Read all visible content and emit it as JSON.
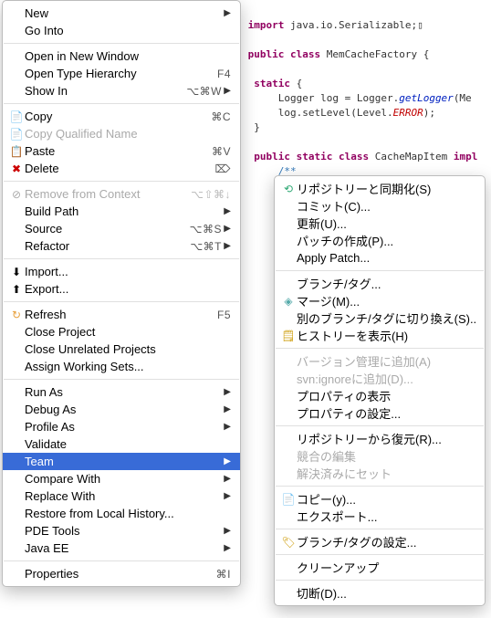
{
  "code": {
    "line1_import": "import",
    "line1_rest": " java.io.Serializable;",
    "line2_public": "public",
    "line2_class": " class",
    "line2_rest": " MemCacheFactory {",
    "line3_static": "static",
    "line3_rest": " {",
    "line4a": "    Logger log = Logger.",
    "line4b": "getLogger",
    "line4c": "(Me",
    "line5a": "    log.setLevel(Level.",
    "line5b": "ERROR",
    "line5c": ");",
    "line6": "}",
    "line7_public": "public",
    "line7_static": " static",
    "line7_class": " class",
    "line7_rest": " CacheMapItem ",
    "line7_impl": "impl",
    "line8_cmt": "    /**",
    "line8b_cmt": "     *"
  },
  "menu": {
    "new": "New",
    "goInto": "Go Into",
    "openNewWindow": "Open in New Window",
    "openTypeH": "Open Type Hierarchy",
    "openTypeH_sc": "F4",
    "showIn": "Show In",
    "showIn_sc": "⌥⌘W",
    "copy": "Copy",
    "copy_sc": "⌘C",
    "copyQ": "Copy Qualified Name",
    "paste": "Paste",
    "paste_sc": "⌘V",
    "delete": "Delete",
    "delete_sc": "⌦",
    "removeCtx": "Remove from Context",
    "removeCtx_sc": "⌥⇧⌘↓",
    "buildPath": "Build Path",
    "source": "Source",
    "source_sc": "⌥⌘S",
    "refactor": "Refactor",
    "refactor_sc": "⌥⌘T",
    "import": "Import...",
    "export": "Export...",
    "refresh": "Refresh",
    "refresh_sc": "F5",
    "closeProject": "Close Project",
    "closeUnrelated": "Close Unrelated Projects",
    "assignWS": "Assign Working Sets...",
    "runAs": "Run As",
    "debugAs": "Debug As",
    "profileAs": "Profile As",
    "validate": "Validate",
    "team": "Team",
    "compareWith": "Compare With",
    "replaceWith": "Replace With",
    "restoreLocal": "Restore from Local History...",
    "pdeTools": "PDE Tools",
    "javaEE": "Java EE",
    "properties": "Properties",
    "properties_sc": "⌘I"
  },
  "submenu": {
    "sync": "リポジトリーと同期化(S)",
    "commit": "コミット(C)...",
    "update": "更新(U)...",
    "createPatch": "パッチの作成(P)...",
    "applyPatch": "Apply Patch...",
    "branchTag": "ブランチ/タグ...",
    "merge": "マージ(M)...",
    "switch": "別のブランチ/タグに切り換え(S)...",
    "history": "ヒストリーを表示(H)",
    "addVC": "バージョン管理に追加(A)",
    "svnIgnore": "svn:ignoreに追加(D)...",
    "propShow": "プロパティの表示",
    "propSet": "プロパティの設定...",
    "revert": "リポジトリーから復元(R)...",
    "editConflict": "競合の編集",
    "resolved": "解決済みにセット",
    "copyY": "コピー(y)...",
    "export": "エクスポート...",
    "branchTagSet": "ブランチ/タグの設定...",
    "cleanup": "クリーンアップ",
    "disconnect": "切断(D)..."
  }
}
